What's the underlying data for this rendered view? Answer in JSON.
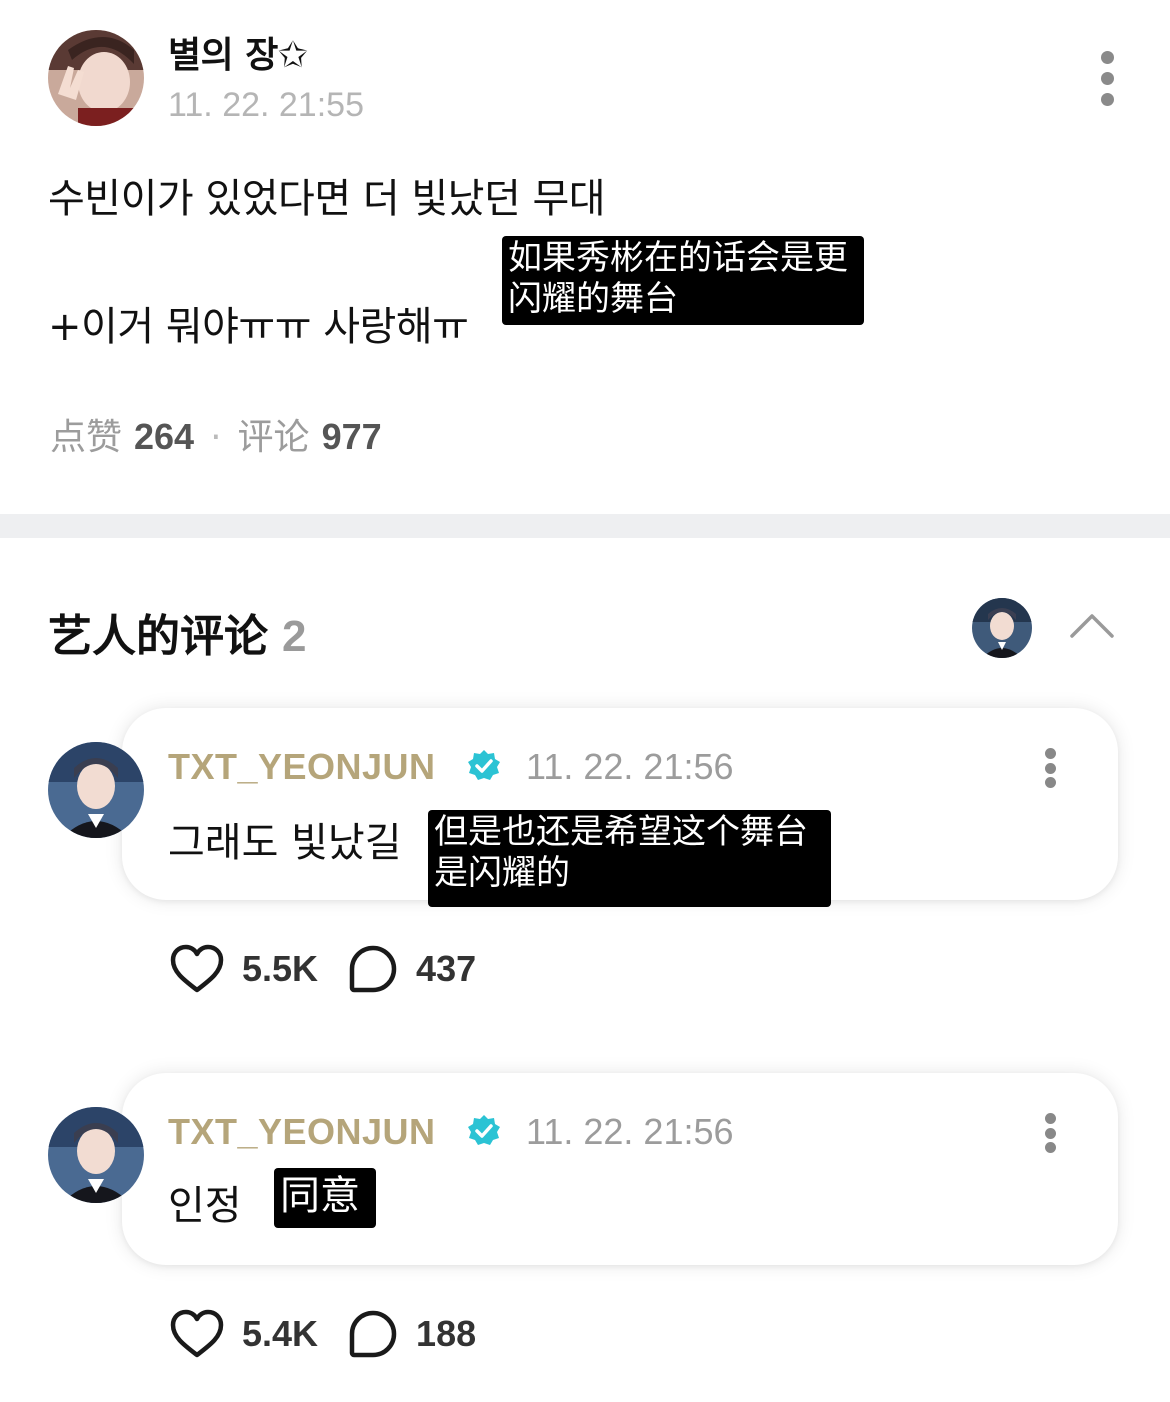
{
  "post": {
    "author": "별의 장✩",
    "time": "11. 22. 21:55",
    "line1": "수빈이가 있었다면 더 빛났던 무대",
    "line2": "+이거 뭐야ㅠㅠ 사랑해ㅠ",
    "subtitle": "如果秀彬在的话会是更闪耀的舞台",
    "likes_label": "点赞",
    "likes_count": "264",
    "comments_label": "评论",
    "comments_count": "977"
  },
  "artist_section": {
    "title": "艺人的评论",
    "count": "2"
  },
  "comments": [
    {
      "name": "TXT_YEONJUN",
      "time": "11. 22. 21:56",
      "text": "그래도 빛났길",
      "subtitle": "但是也还是希望这个舞台是闪耀的",
      "likes": "5.5K",
      "replies": "437"
    },
    {
      "name": "TXT_YEONJUN",
      "time": "11. 22. 21:56",
      "text": "인정",
      "subtitle": "同意",
      "likes": "5.4K",
      "replies": "188"
    }
  ],
  "icons": {
    "more": "kebab-vertical-icon",
    "verified": "verified-badge-icon",
    "like": "heart-outline-icon",
    "reply": "speech-bubble-icon",
    "collapse": "chevron-up-icon"
  },
  "colors": {
    "artist_name": "#b5a57a",
    "verified": "#2bc3d4",
    "muted": "#9c9c9c",
    "divider": "#eeeff1"
  }
}
